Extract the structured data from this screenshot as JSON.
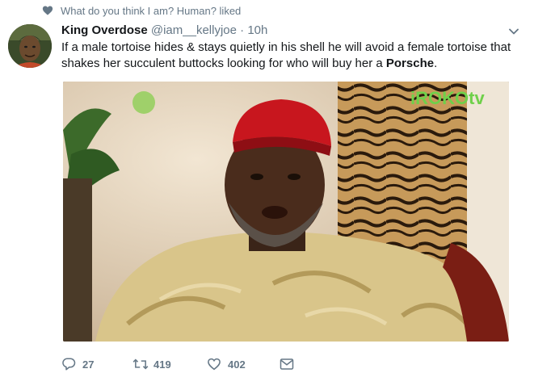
{
  "context": {
    "liked_text": "What do you think I am? Human? liked"
  },
  "tweet": {
    "display_name": "King Overdose",
    "handle": "@iam__kellyjoe",
    "separator": "·",
    "time": "10h",
    "text_before": "If a male tortoise hides & stays quietly in his shell he will avoid a female tortoise that shakes her succulent buttocks looking for who will buy her a ",
    "text_bold": "Porsche",
    "text_after": "."
  },
  "media": {
    "watermark": "iROKOtv"
  },
  "actions": {
    "reply_count": "27",
    "retweet_count": "419",
    "like_count": "402"
  },
  "colors": {
    "icon_gray": "#657786",
    "liked_heart": "#657786",
    "name": "#14171a"
  },
  "icons": [
    "heart-icon",
    "chevron-down-icon",
    "reply-icon",
    "retweet-icon",
    "like-icon",
    "message-icon"
  ]
}
